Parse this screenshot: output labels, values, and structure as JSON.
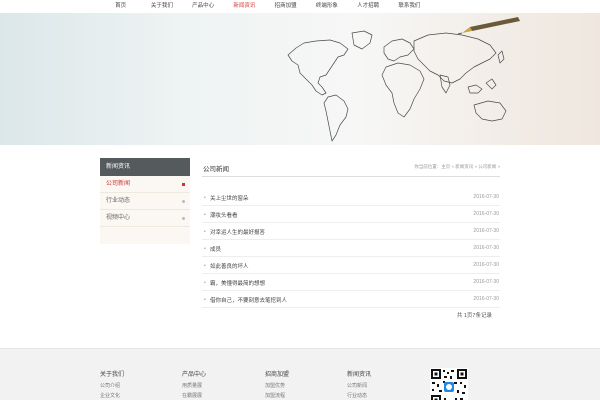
{
  "nav": {
    "items": [
      "首页",
      "关于我们",
      "产品中心",
      "新闻资讯",
      "招商加盟",
      "终端形象",
      "人才招聘",
      "联系我们"
    ],
    "active_index": 3,
    "active_color": "#d43b3b"
  },
  "sidebar": {
    "title": "新闻资讯",
    "items": [
      {
        "label": "公司新闻",
        "active": true
      },
      {
        "label": "行业动态",
        "active": false
      },
      {
        "label": "视频中心",
        "active": false
      }
    ]
  },
  "main": {
    "title": "公司新闻",
    "breadcrumb": "你当前位置：主页 » 新闻资讯 » 公司新闻 »",
    "news": [
      {
        "title": "关上尘世的窗朵",
        "date": "2016-07-30"
      },
      {
        "title": "潮妆头看看",
        "date": "2016-07-30"
      },
      {
        "title": "对幸运人生的最好报答",
        "date": "2016-07-30"
      },
      {
        "title": "成员",
        "date": "2016-07-30"
      },
      {
        "title": "如此善良的坏人",
        "date": "2016-07-30"
      },
      {
        "title": "霸，美懂得最简的想想",
        "date": "2016-07-30"
      },
      {
        "title": "借你自己，不要刻意去笔挖到人",
        "date": "2016-07-30"
      }
    ],
    "pagination": "共 1页7条记录"
  },
  "footer": {
    "columns": [
      {
        "title": "关于我们",
        "links": [
          "公司介绍",
          "企业文化"
        ]
      },
      {
        "title": "产品中心",
        "links": [
          "用质量展",
          "在霸展展"
        ]
      },
      {
        "title": "招商加盟",
        "links": [
          "加盟优势",
          "加盟流程"
        ]
      },
      {
        "title": "新闻资讯",
        "links": [
          "公司新闻",
          "行业动态"
        ]
      }
    ]
  }
}
